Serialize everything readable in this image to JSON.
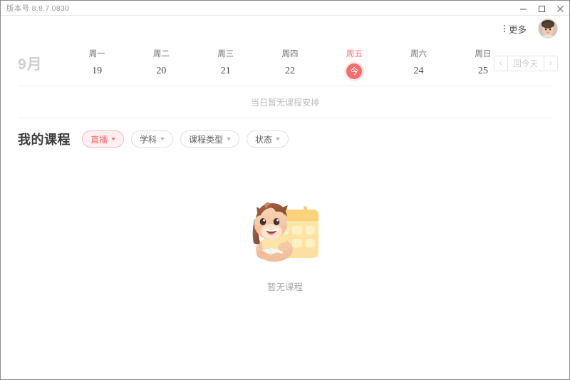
{
  "window": {
    "version_label": "版本号 8.8.7.0830",
    "controls": {
      "minimize": "minimize-icon",
      "maximize": "maximize-icon",
      "close": "close-icon"
    }
  },
  "userbar": {
    "more_label": "更多",
    "more_icon": "vertical-dots-icon",
    "avatar_alt": "user-avatar"
  },
  "calendar": {
    "month_label": "9月",
    "days": [
      {
        "name": "周一",
        "date": "19",
        "today": false
      },
      {
        "name": "周二",
        "date": "20",
        "today": false
      },
      {
        "name": "周三",
        "date": "21",
        "today": false
      },
      {
        "name": "周四",
        "date": "22",
        "today": false
      },
      {
        "name": "周五",
        "date": "今",
        "today": true
      },
      {
        "name": "周六",
        "date": "24",
        "today": false
      },
      {
        "name": "周日",
        "date": "25",
        "today": false
      }
    ],
    "nav": {
      "prev_icon": "chevron-left-icon",
      "today_label": "回今天",
      "next_icon": "chevron-right-icon"
    },
    "empty_notice": "当日暂无课程安排",
    "today_accent_color": "#f96c6c"
  },
  "courses": {
    "title": "我的课程",
    "filters": [
      {
        "label": "直播",
        "active": true
      },
      {
        "label": "学科",
        "active": false
      },
      {
        "label": "课程类型",
        "active": false
      },
      {
        "label": "状态",
        "active": false
      }
    ],
    "empty": {
      "illustration": "pony-with-calendar-illustration",
      "text": "暂无课程"
    }
  }
}
